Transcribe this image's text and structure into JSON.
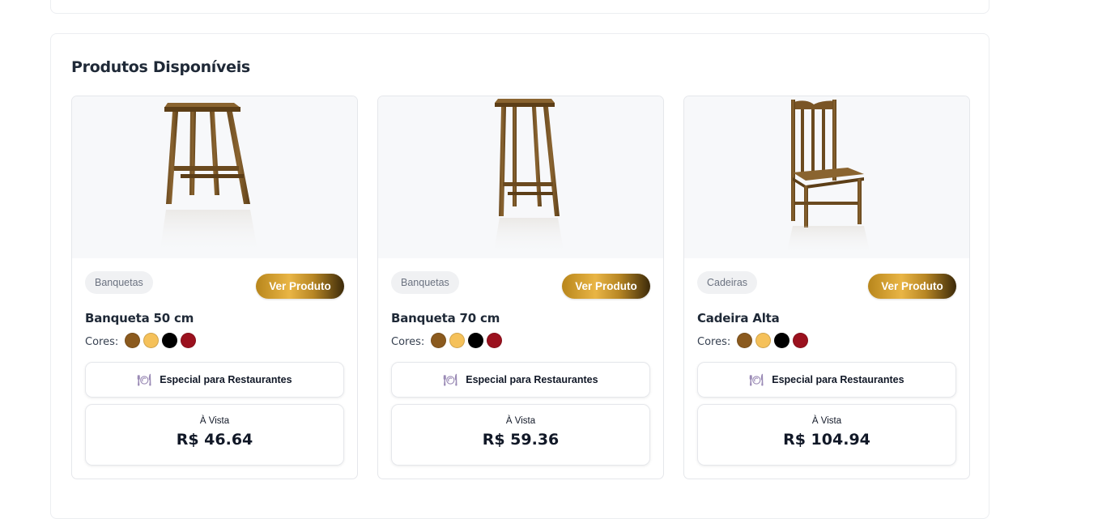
{
  "section": {
    "title": "Produtos Disponíveis"
  },
  "products": [
    {
      "image_icon": "bar-stool-image",
      "category": "Banquetas",
      "view_label": "Ver Produto",
      "name": "Banqueta 50 cm",
      "colors_label": "Cores:",
      "colors": [
        "#8b5a1e",
        "#f5c15a",
        "#000000",
        "#9b111e"
      ],
      "special_label": "Especial para Restaurantes",
      "price_label": "À Vista",
      "price": "R$ 46.64"
    },
    {
      "image_icon": "tall-bar-stool-image",
      "category": "Banquetas",
      "view_label": "Ver Produto",
      "name": "Banqueta 70 cm",
      "colors_label": "Cores:",
      "colors": [
        "#8b5a1e",
        "#f5c15a",
        "#000000",
        "#9b111e"
      ],
      "special_label": "Especial para Restaurantes",
      "price_label": "À Vista",
      "price": "R$ 59.36"
    },
    {
      "image_icon": "high-chair-image",
      "category": "Cadeiras",
      "view_label": "Ver Produto",
      "name": "Cadeira Alta",
      "colors_label": "Cores:",
      "colors": [
        "#8b5a1e",
        "#f5c15a",
        "#000000",
        "#9b111e"
      ],
      "special_label": "Especial para Restaurantes",
      "price_label": "À Vista",
      "price": "R$ 104.94"
    }
  ],
  "icons": {
    "special": "plate-icon"
  },
  "accent": {
    "wood": "#7a5526",
    "gold": "#e9b545"
  }
}
